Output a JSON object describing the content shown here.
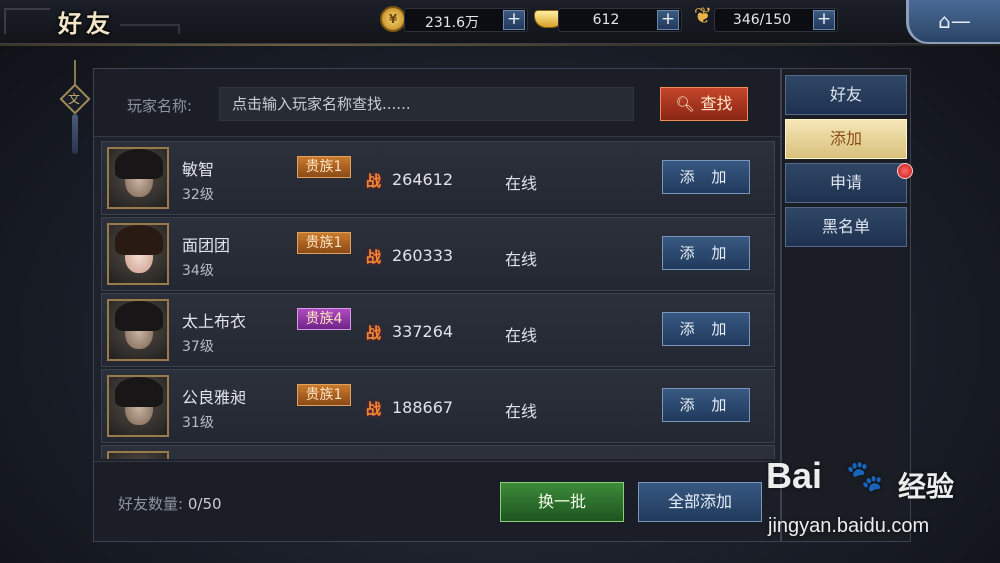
{
  "header": {
    "title": "好友",
    "back_icon": "home-back-icon",
    "resources": [
      {
        "name": "silver",
        "icon": "coin-icon",
        "value": "231.6万"
      },
      {
        "name": "gold",
        "icon": "ingot-icon",
        "value": "612"
      },
      {
        "name": "grain",
        "icon": "wheat-icon",
        "value": "346/150"
      }
    ],
    "plus_label": "+",
    "back_label": "⌂—"
  },
  "search": {
    "label": "玩家名称:",
    "placeholder": "点击输入玩家名称查找......",
    "button_label": "查找"
  },
  "players": [
    {
      "name": "敏智",
      "level": "32级",
      "noble": "贵族1",
      "noble_color": "#c9792c",
      "power": "264612",
      "status": "在线",
      "action": "添 加",
      "avatar": "male"
    },
    {
      "name": "面团团",
      "level": "34级",
      "noble": "贵族1",
      "noble_color": "#c9792c",
      "power": "260333",
      "status": "在线",
      "action": "添 加",
      "avatar": "female"
    },
    {
      "name": "太上布衣",
      "level": "37级",
      "noble": "贵族4",
      "noble_color": "#b04ac0",
      "power": "337264",
      "status": "在线",
      "action": "添 加",
      "avatar": "male"
    },
    {
      "name": "公良雅昶",
      "level": "31级",
      "noble": "贵族1",
      "noble_color": "#c9792c",
      "power": "188667",
      "status": "在线",
      "action": "添 加",
      "avatar": "male"
    }
  ],
  "power_glyph": "战",
  "footer": {
    "friend_count_label": "好友数量:",
    "friend_count_value": "0/50",
    "refresh_label": "换一批",
    "add_all_label": "全部添加"
  },
  "tabs": [
    {
      "label": "好友",
      "active": false,
      "badge": false
    },
    {
      "label": "添加",
      "active": true,
      "badge": false
    },
    {
      "label": "申请",
      "active": false,
      "badge": true
    },
    {
      "label": "黑名单",
      "active": false,
      "badge": false
    }
  ],
  "ornament_glyph": "文",
  "watermark": {
    "brand": "Bai",
    "paw": "🐾",
    "jingyan": "经验",
    "url": "jingyan.baidu.com"
  }
}
